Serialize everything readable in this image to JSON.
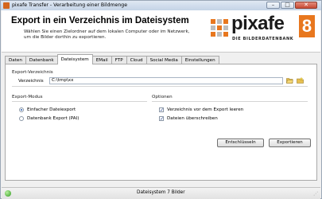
{
  "window": {
    "title": "pixafe Transfer - Verarbeitung einer Bildmenge"
  },
  "header": {
    "title": "Export in ein Verzeichnis im Dateisystem",
    "description": "Wählen Sie einen Zielordner auf dem lokalen Computer oder im Netzwerk, um die Bilder dorthin zu exportieren.",
    "logo_word": "pixafe",
    "logo_number": "8",
    "logo_tagline": "DIE BILDERDATENBANK"
  },
  "tabs": [
    {
      "label": "Daten",
      "active": false
    },
    {
      "label": "Datenbank",
      "active": false
    },
    {
      "label": "Dateisystem",
      "active": true
    },
    {
      "label": "EMail",
      "active": false
    },
    {
      "label": "FTP",
      "active": false
    },
    {
      "label": "Cloud",
      "active": false
    },
    {
      "label": "Social Media",
      "active": false
    },
    {
      "label": "Einstellungen",
      "active": false
    }
  ],
  "export_dir": {
    "group_label": "Export-Verzeichnis",
    "field_label": "Verzeichnis",
    "value": "C:\\tmp\\xx"
  },
  "export_mode": {
    "group_label": "Export-Modus",
    "options": [
      {
        "label": "Einfacher Dateiexport",
        "selected": true
      },
      {
        "label": "Datenbank Export (PAI)",
        "selected": false
      }
    ]
  },
  "options": {
    "group_label": "Optionen",
    "items": [
      {
        "label": "Verzeichnis vor dem Export leeren",
        "checked": true
      },
      {
        "label": "Dateien überschreiben",
        "checked": true
      }
    ]
  },
  "buttons": {
    "decrypt": "Entschlüsseln",
    "export": "Exportieren"
  },
  "status": {
    "text": "Dateisystem 7 Bilder"
  },
  "colors": {
    "accent": "#e8771e",
    "title_bar": "#c4d3e6"
  },
  "icons": [
    "app-icon",
    "open-folder-icon",
    "new-folder-icon",
    "status-ok-icon"
  ]
}
